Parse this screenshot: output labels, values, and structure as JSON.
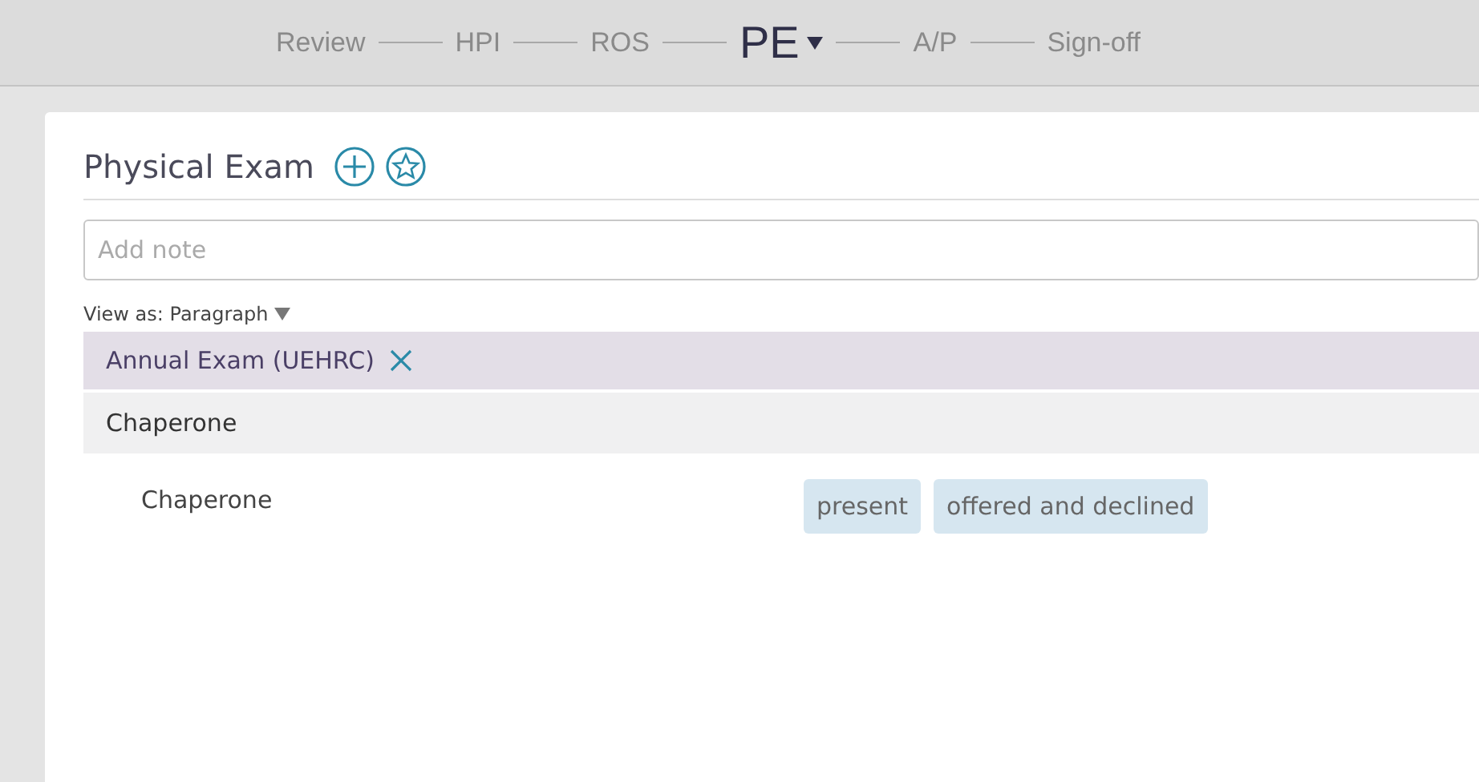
{
  "steps": [
    {
      "label": "Review",
      "selected": false
    },
    {
      "label": "HPI",
      "selected": false
    },
    {
      "label": "ROS",
      "selected": false
    },
    {
      "label": "PE",
      "selected": true
    },
    {
      "label": "A/P",
      "selected": false
    },
    {
      "label": "Sign-off",
      "selected": false
    }
  ],
  "section": {
    "title": "Physical Exam",
    "note": {
      "placeholder": "Add note"
    },
    "view_as": "View as: Paragraph"
  },
  "template": {
    "name": "Annual Exam (UEHRC)"
  },
  "group": {
    "title": "Chaperone"
  },
  "rows": [
    {
      "label": "Chaperone",
      "options": [
        "present",
        "offered and declined"
      ]
    }
  ]
}
